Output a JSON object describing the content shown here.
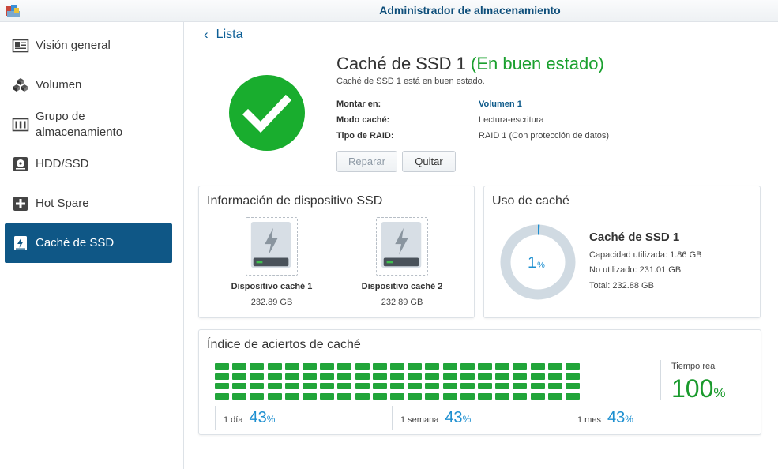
{
  "window": {
    "title": "Administrador de almacenamiento"
  },
  "sidebar": {
    "items": [
      {
        "label": "Visión general",
        "icon": "overview-icon",
        "active": false
      },
      {
        "label": "Volumen",
        "icon": "cubes-icon",
        "active": false
      },
      {
        "label": "Grupo de almacenamiento",
        "icon": "storage-pool-icon",
        "active": false
      },
      {
        "label": "HDD/SSD",
        "icon": "hdd-icon",
        "active": false
      },
      {
        "label": "Hot Spare",
        "icon": "plus-box-icon",
        "active": false
      },
      {
        "label": "Caché de SSD",
        "icon": "ssd-cache-icon",
        "active": true
      }
    ]
  },
  "back_link": {
    "label": "Lista"
  },
  "header": {
    "title": "Caché de SSD 1",
    "status_open": "(",
    "status": "En buen estado",
    "status_close": ")",
    "subtitle": "Caché de SSD 1 está en buen estado.",
    "fields": [
      {
        "key": "Montar en:",
        "value": "Volumen 1",
        "link": true
      },
      {
        "key": "Modo caché:",
        "value": "Lectura-escritura",
        "link": false
      },
      {
        "key": "Tipo de RAID:",
        "value": "RAID 1 (Con protección de datos)",
        "link": false
      }
    ],
    "buttons": {
      "repair": "Reparar",
      "remove": "Quitar"
    }
  },
  "ssd_info": {
    "title": "Información de dispositivo SSD",
    "devices": [
      {
        "name": "Dispositivo caché 1",
        "size": "232.89 GB"
      },
      {
        "name": "Dispositivo caché 2",
        "size": "232.89 GB"
      }
    ]
  },
  "cache_usage": {
    "title": "Uso de caché",
    "percent_value": "1",
    "percent_sign": "%",
    "used_fraction": 0.008,
    "name": "Caché de SSD 1",
    "used": "Capacidad utilizada: 1.86 GB",
    "unused": "No utilizado: 231.01 GB",
    "total": "Total: 232.88 GB"
  },
  "hit_rate": {
    "title": "Índice de aciertos de caché",
    "realtime_label": "Tiempo real",
    "realtime_value": "100",
    "percent_sign": "%",
    "periods": [
      {
        "label": "1 día",
        "value": "43"
      },
      {
        "label": "1 semana",
        "value": "43"
      },
      {
        "label": "1 mes",
        "value": "43"
      }
    ]
  },
  "colors": {
    "accent": "#0f5786",
    "ok_green": "#1aa02e",
    "hit_green": "#22a53a",
    "percent_blue": "#1d8fd0",
    "donut_track": "#d0dae2"
  }
}
